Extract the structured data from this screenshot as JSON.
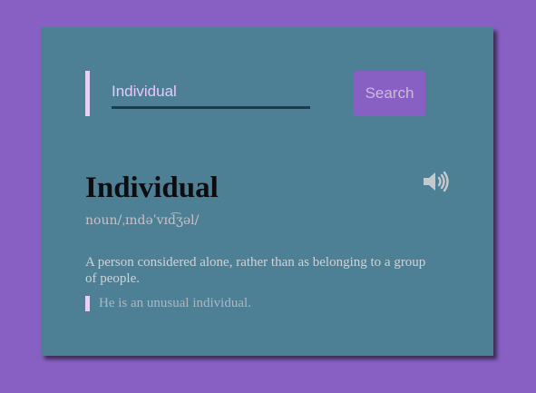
{
  "search": {
    "value": "Individual",
    "button_label": "Search"
  },
  "entry": {
    "word": "Individual",
    "part_of_speech": "noun",
    "phonetic": "/ˌɪndəˈvɪd͡ʒəl/",
    "definition": "A person considered alone, rather than as belonging to a group of people.",
    "example": "He is an unusual individual."
  },
  "icons": {
    "audio": "speaker-volume-icon"
  },
  "colors": {
    "page_background": "#8860c4",
    "card_background": "#4d8095",
    "accent_bar": "#e4d2f4",
    "button_background": "#8860c4",
    "input_text": "#e8c6ff",
    "title_text": "#0b0d10"
  }
}
